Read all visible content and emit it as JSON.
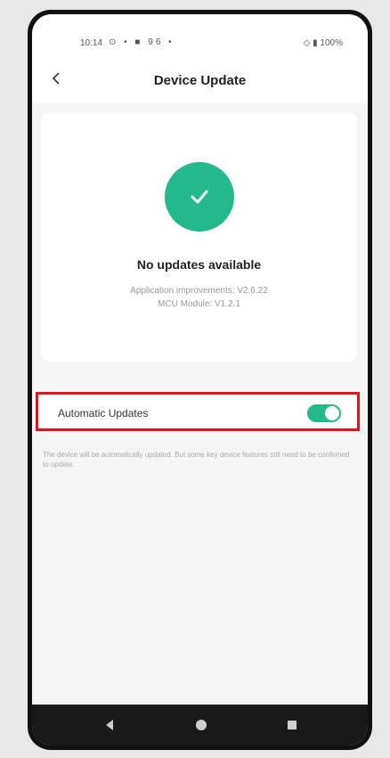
{
  "status_bar": {
    "time": "10:14",
    "left_icons": "⊙ • ■ 96 •",
    "right_text": "100%"
  },
  "header": {
    "title": "Device Update",
    "back_icon": "chevron-left-icon"
  },
  "update_card": {
    "status_icon": "check-circle-icon",
    "title": "No updates available",
    "line1": "Application improvements: V2.6.22",
    "line2": "MCU Module: V1.2.1"
  },
  "settings": {
    "auto_updates_label": "Automatic Updates",
    "auto_updates_enabled": true,
    "note": "The device will be automatically updated. But some key device features still need to be confirmed to update."
  },
  "colors": {
    "accent": "#23b98a",
    "highlight_border": "#e2121e"
  },
  "system_nav": {
    "back_icon": "triangle-back-icon",
    "home_icon": "circle-home-icon",
    "recent_icon": "square-recent-icon"
  }
}
